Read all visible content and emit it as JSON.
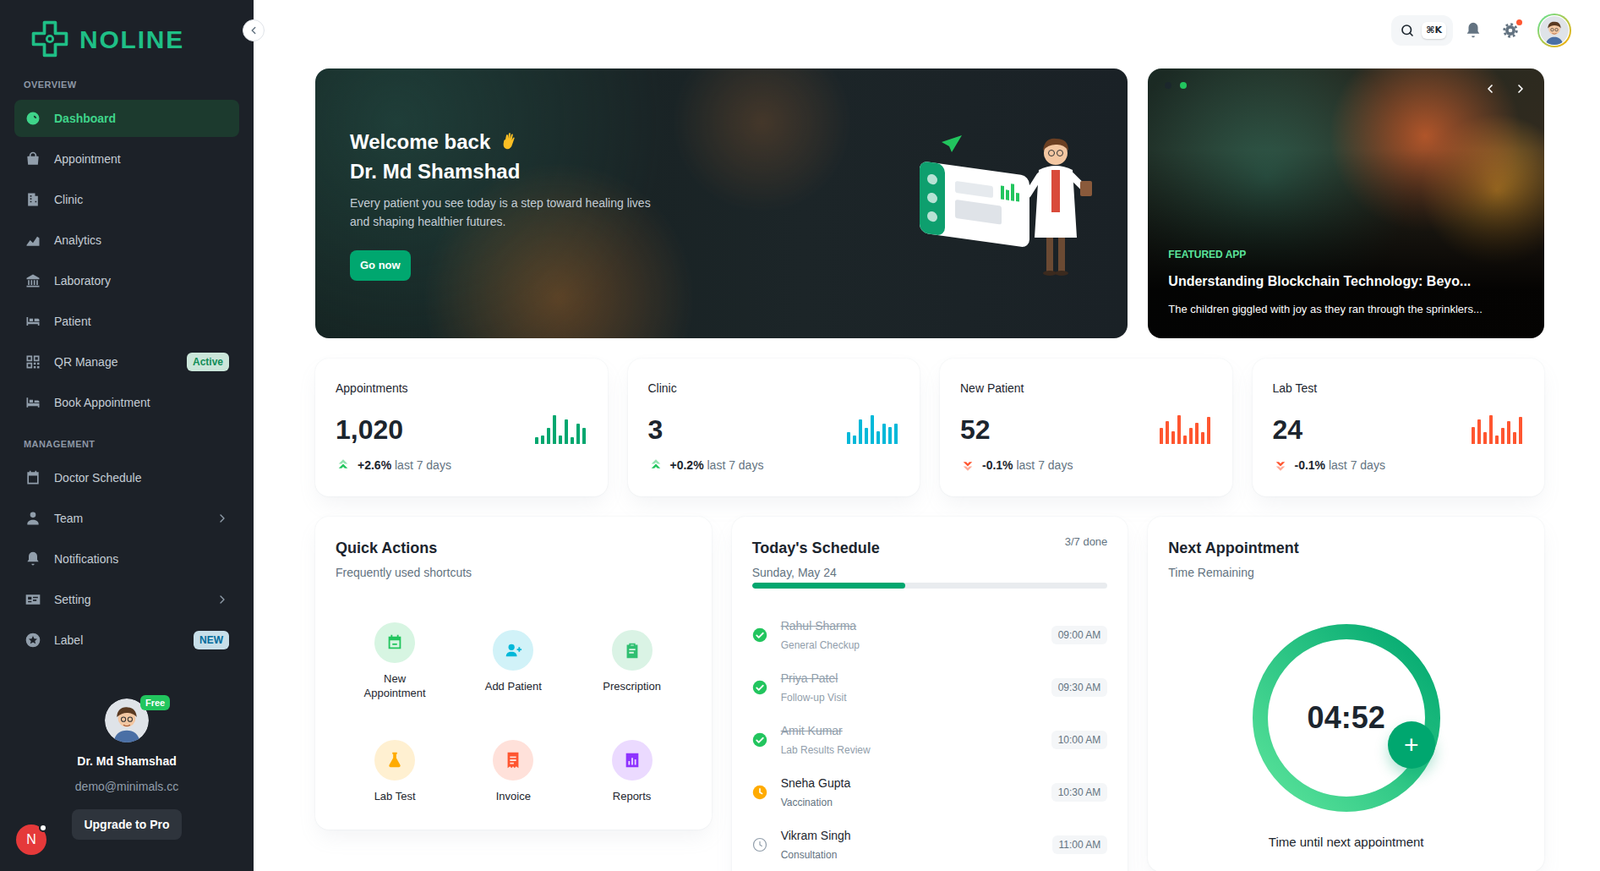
{
  "brand": {
    "name": "NOLINE"
  },
  "sidebar": {
    "sections": [
      {
        "title": "OVERVIEW",
        "items": [
          {
            "label": "Dashboard",
            "selected": true,
            "expandable": false
          },
          {
            "label": "Appointment",
            "selected": false,
            "expandable": false
          },
          {
            "label": "Clinic",
            "selected": false,
            "expandable": false
          },
          {
            "label": "Analytics",
            "selected": false,
            "expandable": false
          },
          {
            "label": "Laboratory",
            "selected": false,
            "expandable": false
          },
          {
            "label": "Patient",
            "selected": false,
            "expandable": false
          },
          {
            "label": "QR Manage",
            "selected": false,
            "expandable": false,
            "badge": "Active",
            "badge_color": "#118d57"
          },
          {
            "label": "Book Appointment",
            "selected": false,
            "expandable": false
          }
        ]
      },
      {
        "title": "MANAGEMENT",
        "items": [
          {
            "label": "Doctor Schedule",
            "selected": false,
            "expandable": false
          },
          {
            "label": "Team",
            "selected": false,
            "expandable": true
          },
          {
            "label": "Notifications",
            "selected": false,
            "expandable": false
          },
          {
            "label": "Setting",
            "selected": false,
            "expandable": true
          },
          {
            "label": "Label",
            "selected": false,
            "expandable": false,
            "badge": "NEW",
            "badge_color": "#006c9c"
          }
        ]
      }
    ],
    "profile": {
      "plan": "Free",
      "name": "Dr. Md Shamshad",
      "email": "demo@minimals.cc",
      "button": "Upgrade to Pro"
    },
    "corner_avatar": {
      "letter": "N",
      "dot": true
    }
  },
  "topbar": {
    "search_shortcut": "⌘K",
    "settings_dot": true
  },
  "hero": {
    "greeting": "Welcome back",
    "name": "Dr. Md Shamshad",
    "text": "Every patient you see today is a step toward healing lives and shaping healthier futures.",
    "button": "Go now"
  },
  "featured": {
    "slides": [
      {
        "selected": false
      },
      {
        "selected": true
      }
    ],
    "label": "FEATURED APP",
    "title": "Understanding Blockchain Technology: Beyo...",
    "description": "The children giggled with joy as they ran through the sprinklers..."
  },
  "stats": [
    {
      "title": "Appointments",
      "value": "1,020",
      "change": "+2.6%",
      "period": "last 7 days",
      "trend": "up",
      "color": "#00a76f",
      "bars": [
        25,
        30,
        55,
        100,
        30,
        85,
        25,
        70,
        55
      ]
    },
    {
      "title": "Clinic",
      "value": "3",
      "change": "+0.2%",
      "period": "last 7 days",
      "trend": "up",
      "color": "#00b8d9",
      "bars": [
        40,
        30,
        85,
        55,
        100,
        45,
        70,
        60,
        70
      ]
    },
    {
      "title": "New Patient",
      "value": "52",
      "change": "-0.1%",
      "period": "last 7 days",
      "trend": "down",
      "color": "#ff5630",
      "bars": [
        55,
        80,
        45,
        100,
        30,
        55,
        75,
        40,
        95
      ]
    },
    {
      "title": "Lab Test",
      "value": "24",
      "change": "-0.1%",
      "period": "last 7 days",
      "trend": "down",
      "color": "#ff5630",
      "bars": [
        60,
        85,
        40,
        100,
        30,
        55,
        80,
        40,
        95
      ]
    }
  ],
  "quick_actions": {
    "title": "Quick Actions",
    "subtitle": "Frequently used shortcuts",
    "items": [
      {
        "label": "New Appointment",
        "color": "#22c55e"
      },
      {
        "label": "Add Patient",
        "color": "#00b8d9"
      },
      {
        "label": "Prescription",
        "color": "#2fbf71"
      },
      {
        "label": "Lab Test",
        "color": "#ffab00"
      },
      {
        "label": "Invoice",
        "color": "#ff5630"
      },
      {
        "label": "Reports",
        "color": "#8e33ff"
      }
    ]
  },
  "schedule": {
    "title": "Today's Schedule",
    "date": "Sunday, May 24",
    "done_label": "3/7 done",
    "level": 0.43,
    "items": [
      {
        "name": "Rahul Sharma",
        "type": "General Checkup",
        "time": "09:00 AM",
        "status": "done"
      },
      {
        "name": "Priya Patel",
        "type": "Follow-up Visit",
        "time": "09:30 AM",
        "status": "done"
      },
      {
        "name": "Amit Kumar",
        "type": "Lab Results Review",
        "time": "10:00 AM",
        "status": "done"
      },
      {
        "name": "Sneha Gupta",
        "type": "Vaccination",
        "time": "10:30 AM",
        "status": "current"
      },
      {
        "name": "Vikram Singh",
        "type": "Consultation",
        "time": "11:00 AM",
        "status": "upcoming"
      }
    ]
  },
  "next_appointment": {
    "title": "Next Appointment",
    "subtitle": "Time Remaining",
    "countdown": "04:52",
    "level": 1,
    "caption": "Time until next appointment",
    "button": "+"
  }
}
